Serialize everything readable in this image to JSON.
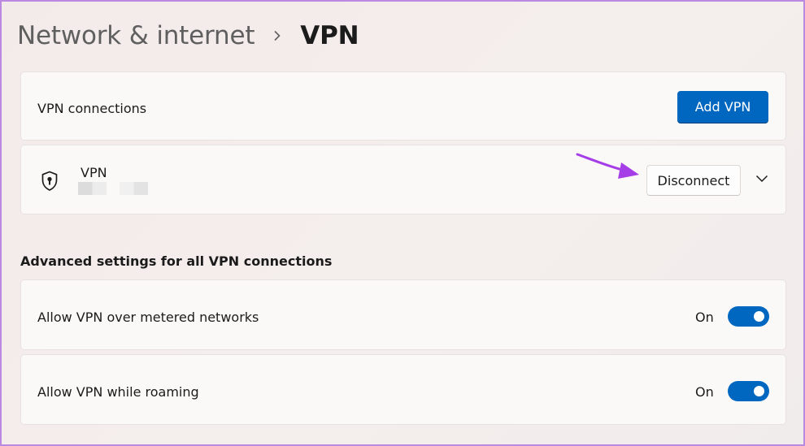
{
  "breadcrumb": {
    "parent": "Network & internet",
    "current": "VPN"
  },
  "connections_card": {
    "label": "VPN connections",
    "add_button": "Add VPN"
  },
  "vpn_item": {
    "icon": "shield-lock-icon",
    "name": "VPN",
    "disconnect_button": "Disconnect",
    "expand_icon": "chevron-down-icon"
  },
  "advanced": {
    "heading": "Advanced settings for all VPN connections",
    "settings": [
      {
        "label": "Allow VPN over metered networks",
        "state": "On",
        "enabled": true
      },
      {
        "label": "Allow VPN while roaming",
        "state": "On",
        "enabled": true
      }
    ]
  },
  "colors": {
    "accent": "#0067c0",
    "annotation": "#a63ee8"
  }
}
